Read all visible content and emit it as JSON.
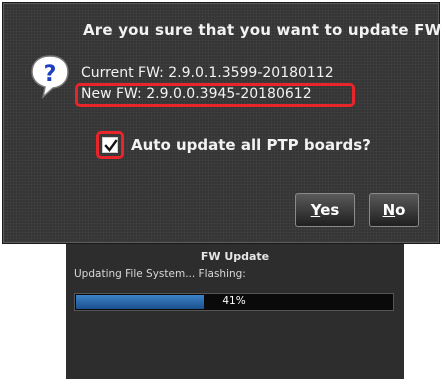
{
  "dialog": {
    "question": "Are you sure that you want to update FW?",
    "current_fw": "Current FW: 2.9.0.1.3599-20180112",
    "new_fw": "New FW: 2.9.0.0.3945-20180612",
    "auto_update_label": "Auto update all PTP boards?",
    "auto_update_checked": true,
    "yes_label": "Yes",
    "no_label": "No",
    "icon": "question-icon"
  },
  "update_panel": {
    "title": "FW Update",
    "status": "Updating File System... Flashing:",
    "progress_label": "41%",
    "progress_fraction": 0.41
  },
  "colors": {
    "highlight": "#e8252a",
    "progress": "#2a6db0",
    "dialog_bg": "#333333"
  }
}
